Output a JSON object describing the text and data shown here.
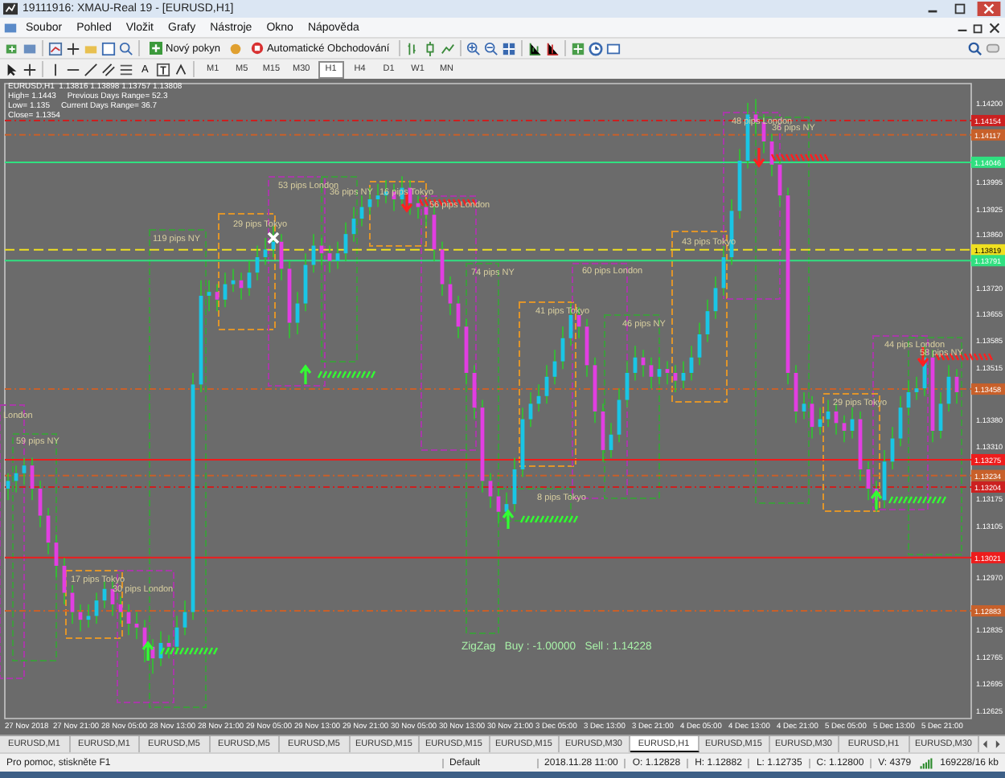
{
  "window": {
    "title": "19111916: XMAU-Real 19 - [EURUSD,H1]"
  },
  "menu": [
    "Soubor",
    "Pohled",
    "Vložit",
    "Grafy",
    "Nástroje",
    "Okno",
    "Nápověda"
  ],
  "toolbar": {
    "new_order": "Nový pokyn",
    "auto_trading": "Automatické Obchodování"
  },
  "drawing_tools": {
    "text_tool": "A"
  },
  "timeframes": [
    {
      "label": "M1",
      "selected": false
    },
    {
      "label": "M5",
      "selected": false
    },
    {
      "label": "M15",
      "selected": false
    },
    {
      "label": "M30",
      "selected": false
    },
    {
      "label": "H1",
      "selected": true
    },
    {
      "label": "H4",
      "selected": false
    },
    {
      "label": "D1",
      "selected": false
    },
    {
      "label": "W1",
      "selected": false
    },
    {
      "label": "MN",
      "selected": false
    }
  ],
  "chart": {
    "info_lines": [
      "EURUSD,H1  1.13816 1.13898 1.13757 1.13808",
      "High= 1.1443     Previous Days Range= 52.3",
      "Low= 1.135     Current Days Range= 36.7",
      "Close= 1.1354"
    ],
    "time_axis": [
      "27 Nov 2018",
      "27 Nov 21:00",
      "28 Nov 05:00",
      "28 Nov 13:00",
      "28 Nov 21:00",
      "29 Nov 05:00",
      "29 Nov 13:00",
      "29 Nov 21:00",
      "30 Nov 05:00",
      "30 Nov 13:00",
      "30 Nov 21:00",
      "3 Dec 05:00",
      "3 Dec 13:00",
      "3 Dec 21:00",
      "4 Dec 05:00",
      "4 Dec 13:00",
      "4 Dec 21:00",
      "5 Dec 05:00",
      "5 Dec 13:00",
      "5 Dec 21:00"
    ],
    "sessions": [
      {
        "label": "119 pips NY",
        "kind": "ny"
      },
      {
        "label": "29 pips Tokyo",
        "kind": "tokyo"
      },
      {
        "label": "53 pips London",
        "kind": "london"
      },
      {
        "label": "36 pips NY",
        "kind": "ny"
      },
      {
        "label": "16 pips Tokyo",
        "kind": "tokyo"
      },
      {
        "label": "56 pips London",
        "kind": "london"
      },
      {
        "label": "74 pips NY",
        "kind": "ny"
      },
      {
        "label": "41 pips Tokyo",
        "kind": "tokyo"
      },
      {
        "label": "60 pips London",
        "kind": "london"
      },
      {
        "label": "46 pips NY",
        "kind": "ny"
      },
      {
        "label": "8 pips Tokyo",
        "kind": "ny"
      },
      {
        "label": "43 pips Tokyo",
        "kind": "tokyo"
      },
      {
        "label": "48 pips London",
        "kind": "london"
      },
      {
        "label": "36 pips NY",
        "kind": "ny"
      },
      {
        "label": "44 pips London",
        "kind": "london"
      },
      {
        "label": "58 pips NY",
        "kind": "ny"
      },
      {
        "label": "29 pips Tokyo",
        "kind": "tokyo"
      },
      {
        "label": "London",
        "kind": "london"
      },
      {
        "label": "59 pips NY",
        "kind": "ny"
      },
      {
        "label": "17 pips Tokyo",
        "kind": "tokyo"
      },
      {
        "label": "30 pips London",
        "kind": "london"
      }
    ],
    "zigzag": "ZigZag   Buy : -1.00000   Sell : 1.14228",
    "chart_data": {
      "type": "candlestick",
      "ylim": [
        1.12604,
        1.1425
      ],
      "ref_lines": [
        {
          "axis": "y",
          "value": 1.14154,
          "label": "1.14154",
          "color": "#cc2020"
        },
        {
          "axis": "y",
          "value": 1.14117,
          "label": "1.14117",
          "color": "#c8602a"
        },
        {
          "axis": "y",
          "value": 1.14046,
          "label": "1.14046",
          "color": "#30e080"
        },
        {
          "axis": "y",
          "value": 1.13819,
          "label": "1.13819",
          "color": "#f0e020"
        },
        {
          "axis": "y",
          "value": 1.13791,
          "label": "1.13791",
          "color": "#30e080"
        },
        {
          "axis": "y",
          "value": 1.13458,
          "label": "1.13458",
          "color": "#c8602a"
        },
        {
          "axis": "y",
          "value": 1.13275,
          "label": "1.13275",
          "color": "#ee1c1c"
        },
        {
          "axis": "y",
          "value": 1.13234,
          "label": "1.13234",
          "color": "#c8602a"
        },
        {
          "axis": "y",
          "value": 1.13204,
          "label": "1.13204",
          "color": "#cc2020"
        },
        {
          "axis": "y",
          "value": 1.13021,
          "label": "1.13021",
          "color": "#ee1c1c"
        },
        {
          "axis": "y",
          "value": 1.12883,
          "label": "1.12883",
          "color": "#c8602a"
        }
      ],
      "yticks": [
        {
          "value": 1.142,
          "label": "1.14200"
        },
        {
          "value": 1.13995,
          "label": "1.13995"
        },
        {
          "value": 1.13925,
          "label": "1.13925"
        },
        {
          "value": 1.1386,
          "label": "1.13860"
        },
        {
          "value": 1.1372,
          "label": "1.13720"
        },
        {
          "value": 1.13655,
          "label": "1.13655"
        },
        {
          "value": 1.13585,
          "label": "1.13585"
        },
        {
          "value": 1.13515,
          "label": "1.13515"
        },
        {
          "value": 1.1338,
          "label": "1.13380"
        },
        {
          "value": 1.1331,
          "label": "1.13310"
        },
        {
          "value": 1.13175,
          "label": "1.13175"
        },
        {
          "value": 1.13105,
          "label": "1.13105"
        },
        {
          "value": 1.1297,
          "label": "1.12970"
        },
        {
          "value": 1.12835,
          "label": "1.12835"
        },
        {
          "value": 1.12765,
          "label": "1.12765"
        },
        {
          "value": 1.12695,
          "label": "1.12695"
        },
        {
          "value": 1.12625,
          "label": "1.12625"
        }
      ],
      "ohlc": [
        [
          1.132,
          1.1324,
          1.1317,
          1.1322
        ],
        [
          1.1322,
          1.1326,
          1.1319,
          1.1324
        ],
        [
          1.1324,
          1.1328,
          1.1321,
          1.1326
        ],
        [
          1.1326,
          1.1328,
          1.1317,
          1.132
        ],
        [
          1.132,
          1.1322,
          1.131,
          1.1313
        ],
        [
          1.1313,
          1.1315,
          1.1303,
          1.1306
        ],
        [
          1.1306,
          1.1308,
          1.1297,
          1.13
        ],
        [
          1.13,
          1.1302,
          1.129,
          1.1293
        ],
        [
          1.1293,
          1.1295,
          1.1285,
          1.1288
        ],
        [
          1.1288,
          1.129,
          1.1283,
          1.1286
        ],
        [
          1.1286,
          1.129,
          1.1284,
          1.1287
        ],
        [
          1.1287,
          1.1293,
          1.1285,
          1.1291
        ],
        [
          1.1291,
          1.1296,
          1.1289,
          1.1294
        ],
        [
          1.1294,
          1.1296,
          1.1287,
          1.129
        ],
        [
          1.129,
          1.1292,
          1.1285,
          1.1288
        ],
        [
          1.1288,
          1.129,
          1.1282,
          1.1285
        ],
        [
          1.1285,
          1.1288,
          1.1281,
          1.1284
        ],
        [
          1.1284,
          1.1286,
          1.1275,
          1.1279
        ],
        [
          1.1279,
          1.1281,
          1.1272,
          1.1276
        ],
        [
          1.1276,
          1.1283,
          1.1274,
          1.128
        ],
        [
          1.128,
          1.1282,
          1.1276,
          1.1279
        ],
        [
          1.1279,
          1.1287,
          1.1277,
          1.1284
        ],
        [
          1.1284,
          1.1291,
          1.1282,
          1.1288
        ],
        [
          1.1288,
          1.135,
          1.1286,
          1.1347
        ],
        [
          1.1347,
          1.1374,
          1.1345,
          1.137
        ],
        [
          1.137,
          1.1374,
          1.1366,
          1.1371
        ],
        [
          1.1371,
          1.1373,
          1.1366,
          1.1369
        ],
        [
          1.1369,
          1.1376,
          1.1367,
          1.1373
        ],
        [
          1.1373,
          1.1377,
          1.1371,
          1.1374
        ],
        [
          1.1374,
          1.1376,
          1.1369,
          1.1372
        ],
        [
          1.1372,
          1.1379,
          1.137,
          1.1376
        ],
        [
          1.1376,
          1.1383,
          1.1374,
          1.138
        ],
        [
          1.138,
          1.1385,
          1.1378,
          1.1382
        ],
        [
          1.1382,
          1.1388,
          1.138,
          1.1384
        ],
        [
          1.1384,
          1.1386,
          1.1374,
          1.1377
        ],
        [
          1.1377,
          1.1379,
          1.1359,
          1.1363
        ],
        [
          1.1363,
          1.1371,
          1.136,
          1.1368
        ],
        [
          1.1368,
          1.1381,
          1.1366,
          1.1378
        ],
        [
          1.1378,
          1.1386,
          1.1376,
          1.1383
        ],
        [
          1.1383,
          1.1385,
          1.1378,
          1.1381
        ],
        [
          1.1381,
          1.1383,
          1.1376,
          1.1379
        ],
        [
          1.1379,
          1.1384,
          1.1377,
          1.1381
        ],
        [
          1.1381,
          1.1389,
          1.1379,
          1.1386
        ],
        [
          1.1386,
          1.1393,
          1.1384,
          1.139
        ],
        [
          1.139,
          1.1396,
          1.1388,
          1.1393
        ],
        [
          1.1393,
          1.1398,
          1.1391,
          1.1395
        ],
        [
          1.1395,
          1.1399,
          1.1393,
          1.1396
        ],
        [
          1.1396,
          1.14,
          1.1394,
          1.1397
        ],
        [
          1.1397,
          1.1399,
          1.1392,
          1.1395
        ],
        [
          1.1395,
          1.1401,
          1.1393,
          1.1398
        ],
        [
          1.1398,
          1.14,
          1.1391,
          1.1394
        ],
        [
          1.1394,
          1.1396,
          1.139,
          1.1393
        ],
        [
          1.1393,
          1.1395,
          1.1388,
          1.1391
        ],
        [
          1.1391,
          1.1393,
          1.1379,
          1.1382
        ],
        [
          1.1382,
          1.1384,
          1.137,
          1.1373
        ],
        [
          1.1373,
          1.1375,
          1.1365,
          1.1368
        ],
        [
          1.1368,
          1.137,
          1.1359,
          1.1362
        ],
        [
          1.1362,
          1.1364,
          1.1347,
          1.135
        ],
        [
          1.135,
          1.1352,
          1.1338,
          1.1341
        ],
        [
          1.1341,
          1.1343,
          1.1319,
          1.1322
        ],
        [
          1.1322,
          1.1324,
          1.1315,
          1.1318
        ],
        [
          1.1318,
          1.132,
          1.1311,
          1.1314
        ],
        [
          1.1314,
          1.1319,
          1.1312,
          1.1316
        ],
        [
          1.1316,
          1.1328,
          1.1314,
          1.1325
        ],
        [
          1.1325,
          1.1341,
          1.1323,
          1.1338
        ],
        [
          1.1338,
          1.1345,
          1.1336,
          1.1342
        ],
        [
          1.1342,
          1.1347,
          1.134,
          1.1344
        ],
        [
          1.1344,
          1.1352,
          1.1342,
          1.1349
        ],
        [
          1.1349,
          1.1356,
          1.1347,
          1.1353
        ],
        [
          1.1353,
          1.1362,
          1.1351,
          1.1359
        ],
        [
          1.1359,
          1.1368,
          1.1357,
          1.1365
        ],
        [
          1.1365,
          1.1367,
          1.1359,
          1.1362
        ],
        [
          1.1362,
          1.1364,
          1.1349,
          1.1352
        ],
        [
          1.1352,
          1.1354,
          1.1337,
          1.134
        ],
        [
          1.134,
          1.1342,
          1.1327,
          1.133
        ],
        [
          1.133,
          1.1337,
          1.1328,
          1.1334
        ],
        [
          1.1334,
          1.1346,
          1.1332,
          1.1343
        ],
        [
          1.1343,
          1.1353,
          1.1341,
          1.135
        ],
        [
          1.135,
          1.1357,
          1.1348,
          1.1354
        ],
        [
          1.1354,
          1.1356,
          1.1349,
          1.1352
        ],
        [
          1.1352,
          1.1354,
          1.1346,
          1.1349
        ],
        [
          1.1349,
          1.1354,
          1.1347,
          1.1351
        ],
        [
          1.1351,
          1.1353,
          1.1347,
          1.135
        ],
        [
          1.135,
          1.1352,
          1.1345,
          1.1348
        ],
        [
          1.1348,
          1.1353,
          1.1346,
          1.135
        ],
        [
          1.135,
          1.1357,
          1.1348,
          1.1354
        ],
        [
          1.1354,
          1.1363,
          1.1352,
          1.136
        ],
        [
          1.136,
          1.1369,
          1.1358,
          1.1366
        ],
        [
          1.1366,
          1.1375,
          1.1364,
          1.1372
        ],
        [
          1.1372,
          1.1383,
          1.137,
          1.138
        ],
        [
          1.138,
          1.1395,
          1.1378,
          1.1392
        ],
        [
          1.1392,
          1.1408,
          1.139,
          1.1405
        ],
        [
          1.1405,
          1.142,
          1.1403,
          1.1417
        ],
        [
          1.1417,
          1.1421,
          1.1412,
          1.1415
        ],
        [
          1.1415,
          1.1417,
          1.1407,
          1.141
        ],
        [
          1.141,
          1.1412,
          1.1401,
          1.1404
        ],
        [
          1.1404,
          1.1406,
          1.1393,
          1.1396
        ],
        [
          1.1396,
          1.1398,
          1.1347,
          1.135
        ],
        [
          1.135,
          1.1352,
          1.1337,
          1.134
        ],
        [
          1.134,
          1.1345,
          1.1338,
          1.1342
        ],
        [
          1.1342,
          1.1344,
          1.1333,
          1.1336
        ],
        [
          1.1336,
          1.1341,
          1.1334,
          1.1338
        ],
        [
          1.1338,
          1.1343,
          1.1336,
          1.134
        ],
        [
          1.134,
          1.1342,
          1.1334,
          1.1337
        ],
        [
          1.1337,
          1.1339,
          1.1332,
          1.1335
        ],
        [
          1.1335,
          1.1341,
          1.1333,
          1.1338
        ],
        [
          1.1338,
          1.134,
          1.1322,
          1.1325
        ],
        [
          1.1325,
          1.1327,
          1.1317,
          1.132
        ],
        [
          1.132,
          1.1322,
          1.1314,
          1.1317
        ],
        [
          1.1317,
          1.133,
          1.1315,
          1.1327
        ],
        [
          1.1327,
          1.1336,
          1.1325,
          1.1333
        ],
        [
          1.1333,
          1.1344,
          1.1331,
          1.1341
        ],
        [
          1.1341,
          1.1348,
          1.1339,
          1.1345
        ],
        [
          1.1345,
          1.1349,
          1.1343,
          1.1346
        ],
        [
          1.1346,
          1.1357,
          1.1344,
          1.1354
        ],
        [
          1.1354,
          1.1356,
          1.1332,
          1.1335
        ],
        [
          1.1335,
          1.1345,
          1.1333,
          1.1342
        ],
        [
          1.1342,
          1.1352,
          1.134,
          1.1349
        ],
        [
          1.1349,
          1.1351,
          1.1342,
          1.1345
        ]
      ]
    }
  },
  "tabs": [
    {
      "label": "EURUSD,M1",
      "selected": false
    },
    {
      "label": "EURUSD,M1",
      "selected": false
    },
    {
      "label": "EURUSD,M5",
      "selected": false
    },
    {
      "label": "EURUSD,M5",
      "selected": false
    },
    {
      "label": "EURUSD,M5",
      "selected": false
    },
    {
      "label": "EURUSD,M15",
      "selected": false
    },
    {
      "label": "EURUSD,M15",
      "selected": false
    },
    {
      "label": "EURUSD,M15",
      "selected": false
    },
    {
      "label": "EURUSD,M30",
      "selected": false
    },
    {
      "label": "EURUSD,H1",
      "selected": true
    },
    {
      "label": "EURUSD,M15",
      "selected": false
    },
    {
      "label": "EURUSD,M30",
      "selected": false
    },
    {
      "label": "EURUSD,H1",
      "selected": false
    },
    {
      "label": "EURUSD,M30",
      "selected": false
    }
  ],
  "status_bar": {
    "help": "Pro pomoc, stiskněte F1",
    "profile": "Default",
    "time": "2018.11.28 11:00",
    "open": "O: 1.12828",
    "high": "H: 1.12882",
    "low": "L: 1.12735",
    "close": "C: 1.12800",
    "volume": "V: 4379",
    "traffic": "169228/16 kb"
  }
}
